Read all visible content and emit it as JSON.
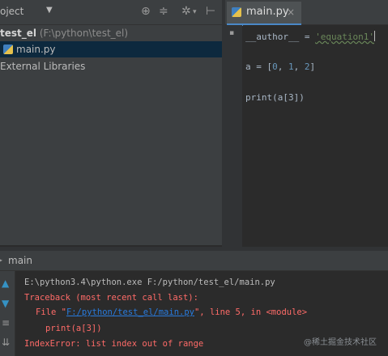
{
  "project_panel": {
    "label": "oject",
    "root_name": "test_el",
    "root_path": "(F:\\python\\test_el)",
    "file": "main.py",
    "external": "External Libraries"
  },
  "editor": {
    "tab_label": "main.py",
    "tab_close": "×",
    "gutter_mark": "▪",
    "line1_pre": "__author__ = ",
    "line1_str": "'equation1'",
    "line2_pre": "a = [",
    "line2_n0": "0",
    "line2_sep1": ", ",
    "line2_n1": "1",
    "line2_sep2": ", ",
    "line2_n2": "2",
    "line2_post": "]",
    "line3": "print(a[3])"
  },
  "run_panel": {
    "title": "main",
    "cmd": "E:\\python3.4\\python.exe F:/python/test_el/main.py",
    "traceback": "Traceback (most recent call last):",
    "file_pre": "File \"",
    "file_link": "F:/python/test_el/main.py",
    "file_post": "\", line 5, in <module>",
    "code_line": "print(a[3])",
    "error": "IndexError: list index out of range"
  },
  "watermark": "@稀土掘金技术社区",
  "icons": [
    "dropdown-arrow-icon",
    "target-icon",
    "collapse-icon",
    "gear-icon",
    "pin-icon",
    "python-file-icon",
    "close-icon",
    "run-icon",
    "up-arrow-icon",
    "down-arrow-icon",
    "wrap-icon"
  ]
}
